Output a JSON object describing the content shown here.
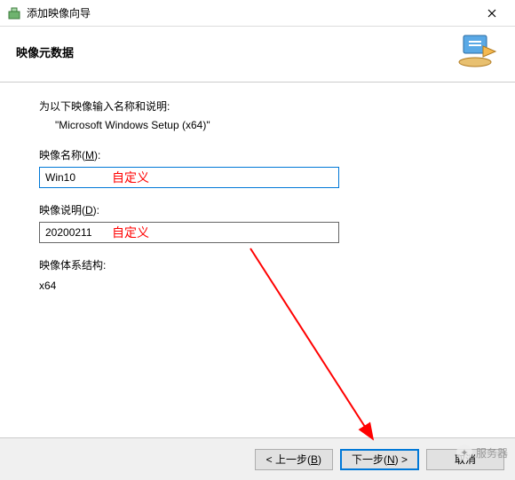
{
  "window": {
    "title": "添加映像向导"
  },
  "header": {
    "title": "映像元数据"
  },
  "content": {
    "intro": "为以下映像输入名称和说明:",
    "subintro": "\"Microsoft Windows Setup (x64)\"",
    "name_label_prefix": "映像名称(",
    "name_label_key": "M",
    "name_label_suffix": "):",
    "name_value": "Win10",
    "name_annotation": "自定义",
    "desc_label_prefix": "映像说明(",
    "desc_label_key": "D",
    "desc_label_suffix": "):",
    "desc_value": "20200211",
    "desc_annotation": "自定义",
    "arch_label": "映像体系结构:",
    "arch_value": "x64"
  },
  "footer": {
    "back_prefix": "< 上一步(",
    "back_key": "B",
    "back_suffix": ")",
    "next_prefix": "下一步(",
    "next_key": "N",
    "next_suffix": ") >",
    "cancel": "取消"
  },
  "watermark": {
    "text": "服务器"
  }
}
